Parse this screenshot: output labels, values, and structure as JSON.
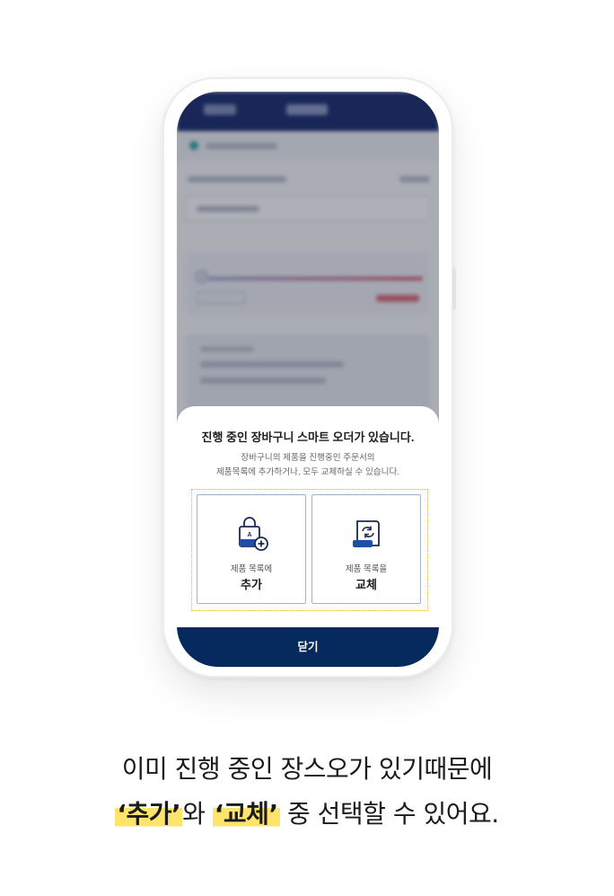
{
  "dialog": {
    "title": "진행 중인 장바구니 스마트 오더가 있습니다.",
    "description_line1": "장바구니의 제품을 진행중인 주문서의",
    "description_line2": "제품목록에 추가하거나, 모두 교체하실 수 있습니다.",
    "options": [
      {
        "sub": "제품 목록에",
        "main": "추가",
        "icon": "shopping-bag-plus-icon"
      },
      {
        "sub": "제품 목록을",
        "main": "교체",
        "icon": "document-swap-icon"
      }
    ],
    "close_label": "닫기"
  },
  "caption": {
    "line1": "이미 진행 중인 장스오가 있기때문에",
    "highlight1": "‘추가’",
    "connector": "와 ",
    "highlight2": "‘교체’",
    "rest": " 중 선택할 수 있어요."
  },
  "colors": {
    "navy": "#062a5e",
    "highlight": "#ffe46b",
    "dotted_border": "#e8b63a",
    "accent_blue": "#1e4fa8"
  }
}
